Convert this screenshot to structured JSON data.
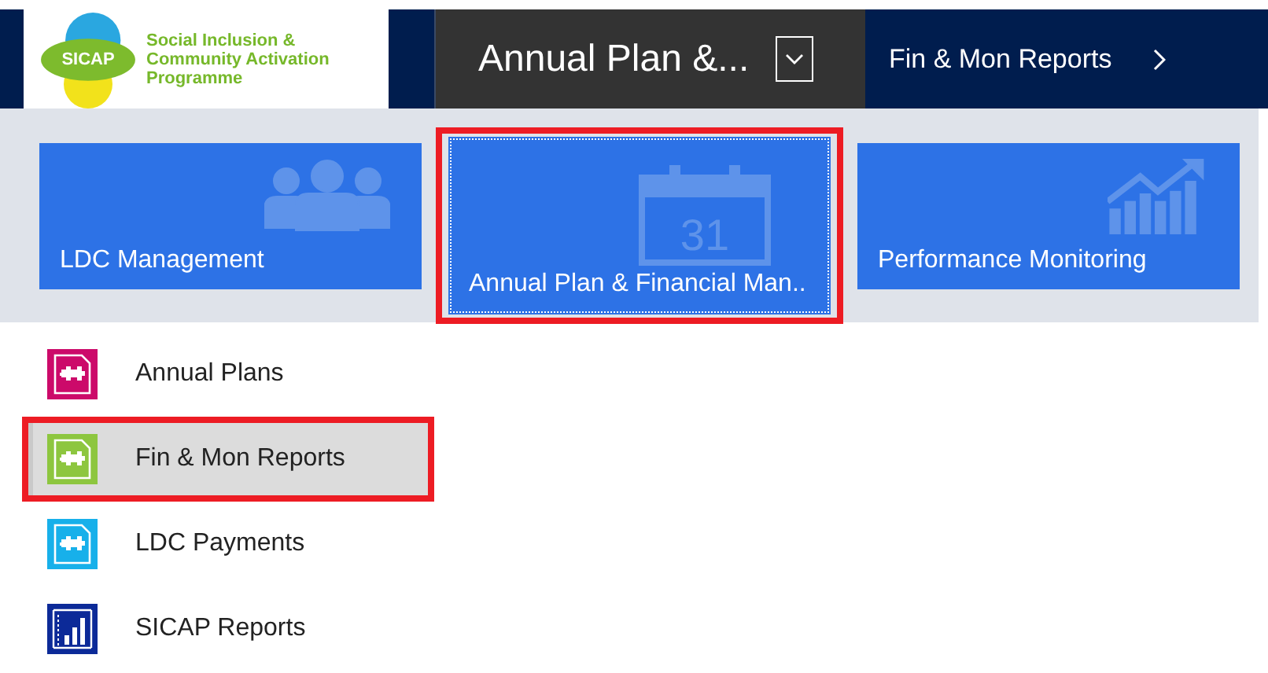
{
  "header": {
    "logo": {
      "badge": "SICAP",
      "lines": [
        "Social Inclusion &",
        "Community Activation",
        "Programme"
      ]
    },
    "area_menu": {
      "label": "Annual Plan &..."
    },
    "breadcrumb": {
      "label": "Fin & Mon Reports"
    }
  },
  "tiles": [
    {
      "label": "LDC Management",
      "kind": "people",
      "selected": false
    },
    {
      "label": "Annual Plan & Financial Man..",
      "kind": "calendar",
      "icon_text": "31",
      "selected": true
    },
    {
      "label": "Performance Monitoring",
      "kind": "chart",
      "selected": false
    }
  ],
  "items": [
    {
      "label": "Annual Plans",
      "kind": "document",
      "color": "#cc0a6a",
      "selected": false
    },
    {
      "label": "Fin & Mon Reports",
      "kind": "document",
      "color": "#8dc63f",
      "selected": true
    },
    {
      "label": "LDC Payments",
      "kind": "document",
      "color": "#17b0ea",
      "selected": false
    },
    {
      "label": "SICAP Reports",
      "kind": "chart",
      "color": "#0c2a98",
      "selected": false
    }
  ]
}
